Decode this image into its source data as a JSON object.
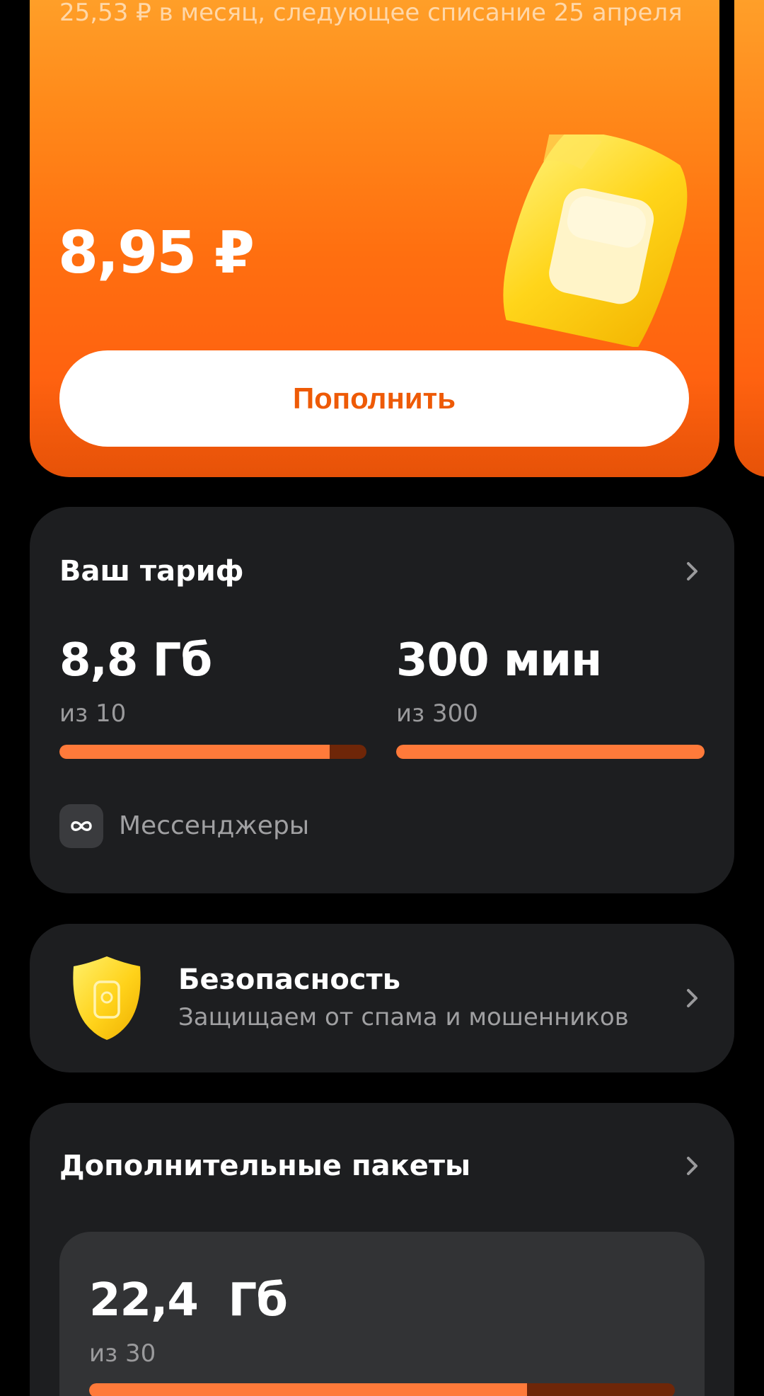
{
  "balance": {
    "subtitle": "25,53 ₽ в месяц, следующее списание 25 апреля",
    "amount": "8,95 ₽",
    "topup_label": "Пополнить",
    "accent_color": "#ff6a10"
  },
  "tariff": {
    "title": "Ваш тариф",
    "data": {
      "value": "8,8 Гб",
      "total": "из 10",
      "remaining_fraction": 0.88
    },
    "minutes": {
      "value": "300 мин",
      "total": "из 300",
      "remaining_fraction": 1.0
    },
    "messengers": {
      "label": "Мессенджеры",
      "icon": "infinity-icon"
    }
  },
  "security": {
    "title": "Безопасность",
    "subtitle": "Защищаем от спама и мошенников",
    "icon": "shield-icon"
  },
  "packages": {
    "title": "Дополнительные пакеты",
    "item": {
      "value": "22,4  Гб",
      "total": "из 30",
      "remaining_fraction": 0.747
    }
  }
}
